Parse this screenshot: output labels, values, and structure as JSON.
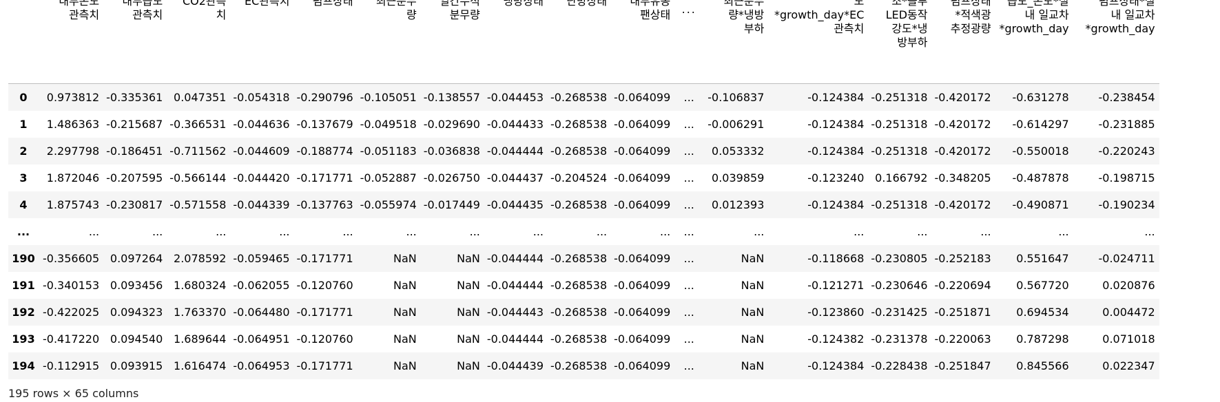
{
  "table": {
    "index_header": "",
    "columns": [
      "내부온도\n관측치",
      "내부습도\n관측치",
      "CO2관측\n치",
      "EC관측치",
      "펌프상태",
      "최근분무\n량",
      "일간누적\n분무량",
      "냉방상태",
      "난방상태",
      "내부유동\n팬상태",
      "...",
      "최근분무\n량*냉방\n부하",
      "도\n*growth_day*EC\n관측치",
      "조*블루\nLED동작\n강도*냉\n방부하",
      "펌프상태\n*적색광\n추정광량",
      "습도_온도*실\n내 일교차\n*growth_day",
      "펌프상태*실\n내 일교차\n*growth_day"
    ],
    "rows": [
      {
        "idx": "0",
        "cells": [
          "0.973812",
          "-0.335361",
          "0.047351",
          "-0.054318",
          "-0.290796",
          "-0.105051",
          "-0.138557",
          "-0.044453",
          "-0.268538",
          "-0.064099",
          "...",
          "-0.106837",
          "-0.124384",
          "-0.251318",
          "-0.420172",
          "-0.631278",
          "-0.238454"
        ]
      },
      {
        "idx": "1",
        "cells": [
          "1.486363",
          "-0.215687",
          "-0.366531",
          "-0.044636",
          "-0.137679",
          "-0.049518",
          "-0.029690",
          "-0.044433",
          "-0.268538",
          "-0.064099",
          "...",
          "-0.006291",
          "-0.124384",
          "-0.251318",
          "-0.420172",
          "-0.614297",
          "-0.231885"
        ]
      },
      {
        "idx": "2",
        "cells": [
          "2.297798",
          "-0.186451",
          "-0.711562",
          "-0.044609",
          "-0.188774",
          "-0.051183",
          "-0.036838",
          "-0.044444",
          "-0.268538",
          "-0.064099",
          "...",
          "0.053332",
          "-0.124384",
          "-0.251318",
          "-0.420172",
          "-0.550018",
          "-0.220243"
        ]
      },
      {
        "idx": "3",
        "cells": [
          "1.872046",
          "-0.207595",
          "-0.566144",
          "-0.044420",
          "-0.171771",
          "-0.052887",
          "-0.026750",
          "-0.044437",
          "-0.204524",
          "-0.064099",
          "...",
          "0.039859",
          "-0.123240",
          "0.166792",
          "-0.348205",
          "-0.487878",
          "-0.198715"
        ]
      },
      {
        "idx": "4",
        "cells": [
          "1.875743",
          "-0.230817",
          "-0.571558",
          "-0.044339",
          "-0.137763",
          "-0.055974",
          "-0.017449",
          "-0.044435",
          "-0.268538",
          "-0.064099",
          "...",
          "0.012393",
          "-0.124384",
          "-0.251318",
          "-0.420172",
          "-0.490871",
          "-0.190234"
        ]
      },
      {
        "idx": "...",
        "cells": [
          "...",
          "...",
          "...",
          "...",
          "...",
          "...",
          "...",
          "...",
          "...",
          "...",
          "...",
          "...",
          "...",
          "...",
          "...",
          "...",
          "..."
        ]
      },
      {
        "idx": "190",
        "cells": [
          "-0.356605",
          "0.097264",
          "2.078592",
          "-0.059465",
          "-0.171771",
          "NaN",
          "NaN",
          "-0.044444",
          "-0.268538",
          "-0.064099",
          "...",
          "NaN",
          "-0.118668",
          "-0.230805",
          "-0.252183",
          "0.551647",
          "-0.024711"
        ]
      },
      {
        "idx": "191",
        "cells": [
          "-0.340153",
          "0.093456",
          "1.680324",
          "-0.062055",
          "-0.120760",
          "NaN",
          "NaN",
          "-0.044444",
          "-0.268538",
          "-0.064099",
          "...",
          "NaN",
          "-0.121271",
          "-0.230646",
          "-0.220694",
          "0.567720",
          "0.020876"
        ]
      },
      {
        "idx": "192",
        "cells": [
          "-0.422025",
          "0.094323",
          "1.763370",
          "-0.064480",
          "-0.171771",
          "NaN",
          "NaN",
          "-0.044443",
          "-0.268538",
          "-0.064099",
          "...",
          "NaN",
          "-0.123860",
          "-0.231425",
          "-0.251871",
          "0.694534",
          "0.004472"
        ]
      },
      {
        "idx": "193",
        "cells": [
          "-0.417220",
          "0.094540",
          "1.689644",
          "-0.064951",
          "-0.120760",
          "NaN",
          "NaN",
          "-0.044444",
          "-0.268538",
          "-0.064099",
          "...",
          "NaN",
          "-0.124382",
          "-0.231378",
          "-0.220063",
          "0.787298",
          "0.071018"
        ]
      },
      {
        "idx": "194",
        "cells": [
          "-0.112915",
          "0.093915",
          "1.616474",
          "-0.064953",
          "-0.171771",
          "NaN",
          "NaN",
          "-0.044439",
          "-0.268538",
          "-0.064099",
          "...",
          "NaN",
          "-0.124384",
          "-0.228438",
          "-0.251847",
          "0.845566",
          "0.022347"
        ]
      }
    ]
  },
  "footer": {
    "shape_text": "195 rows × 65 columns"
  }
}
